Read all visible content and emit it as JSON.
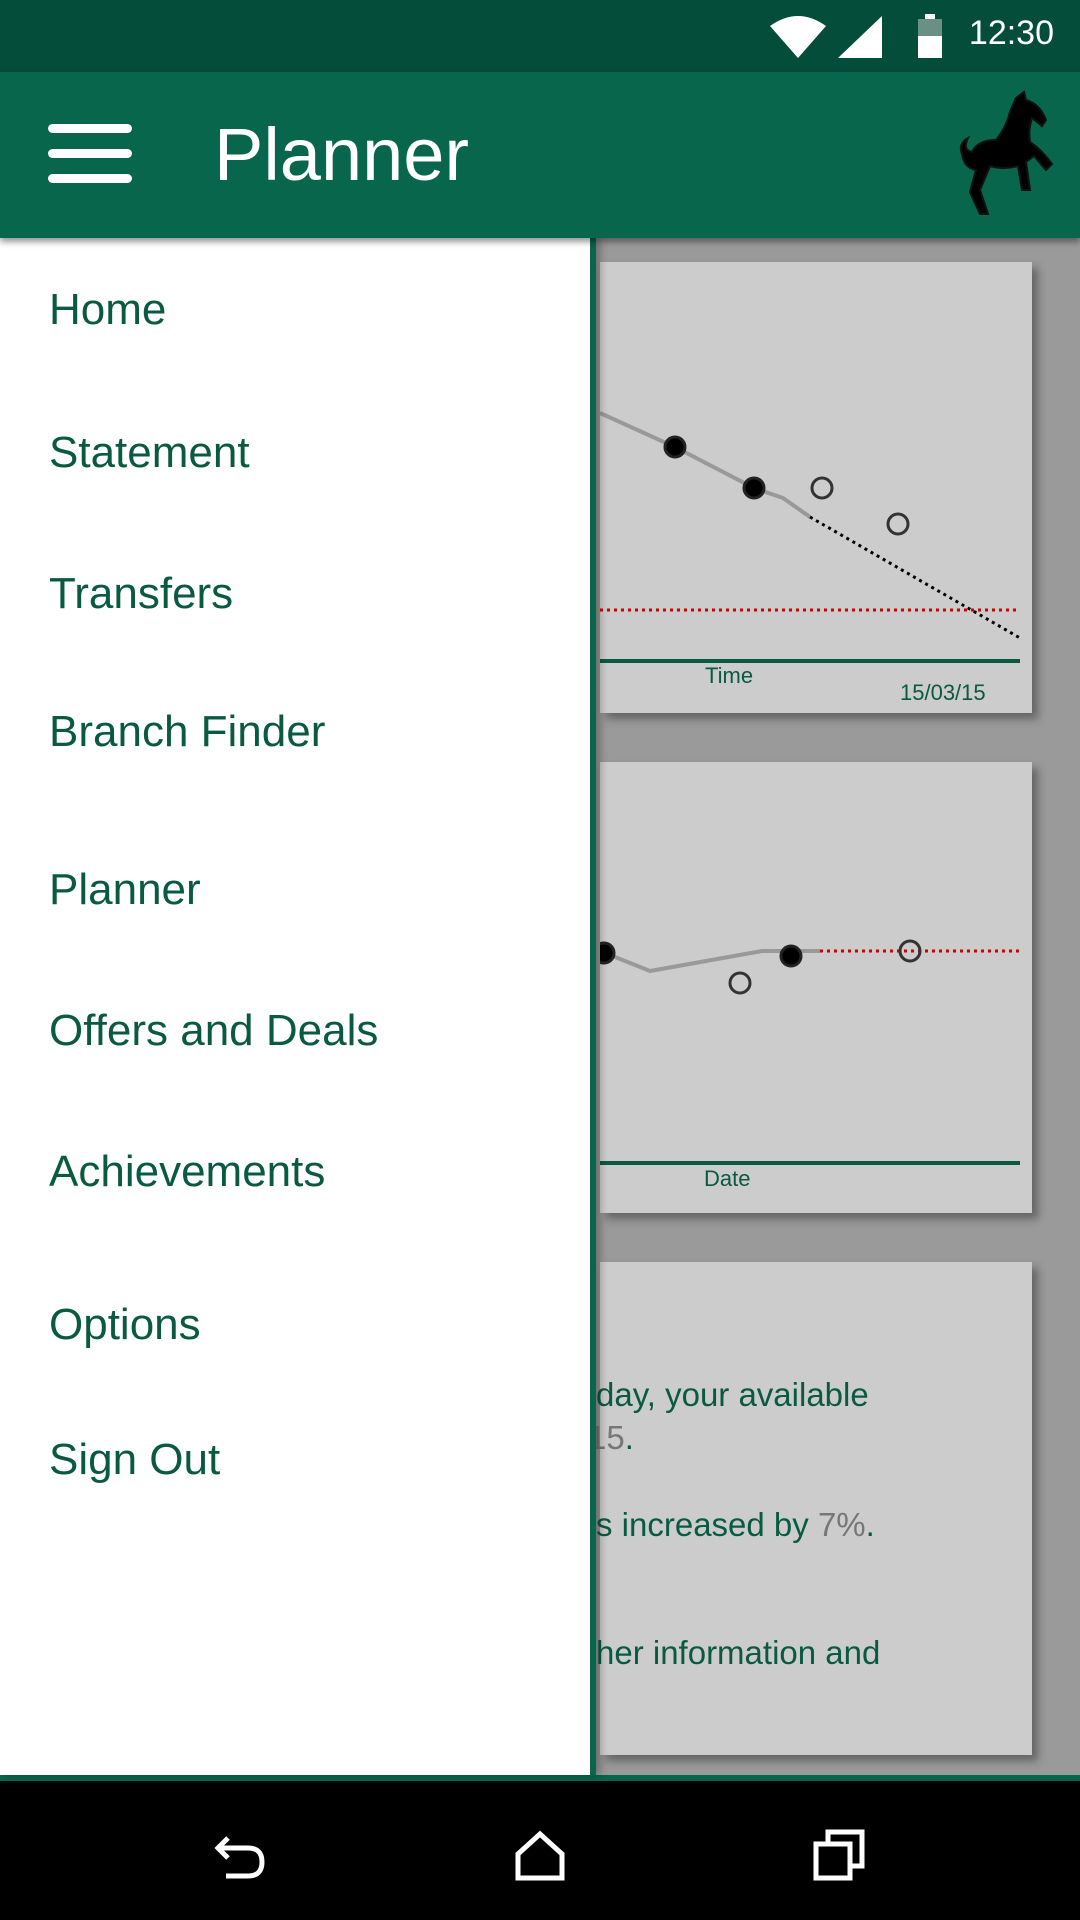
{
  "status_bar": {
    "time": "12:30",
    "icons": [
      "wifi-icon",
      "signal-icon",
      "battery-icon"
    ]
  },
  "app_bar": {
    "title": "Planner",
    "menu_icon": "hamburger-icon",
    "logo": "black-horse-logo"
  },
  "drawer": {
    "items": [
      {
        "label": "Home"
      },
      {
        "label": "Statement"
      },
      {
        "label": "Transfers"
      },
      {
        "label": "Branch Finder"
      },
      {
        "label": "Planner"
      },
      {
        "label": "Offers and Deals"
      },
      {
        "label": "Achievements"
      },
      {
        "label": "Options"
      },
      {
        "label": "Sign Out"
      }
    ]
  },
  "cards": {
    "balance_chart": {
      "x_label": "Time",
      "date": "15/03/15"
    },
    "date_chart": {
      "x_label": "Date"
    },
    "summary": {
      "line1": "day, your available",
      "line2_value": "15",
      "line2_end": ".",
      "line3": "s increased by ",
      "line3_value": "7%",
      "line3_end": ".",
      "line4": "her information and"
    }
  },
  "colors": {
    "primary": "#07664b",
    "status_bar": "#054d3b",
    "text": "#0a5a42",
    "threshold": "#cc0000"
  },
  "nav_bar": {
    "icons": [
      "back-icon",
      "home-icon",
      "recents-icon"
    ]
  }
}
